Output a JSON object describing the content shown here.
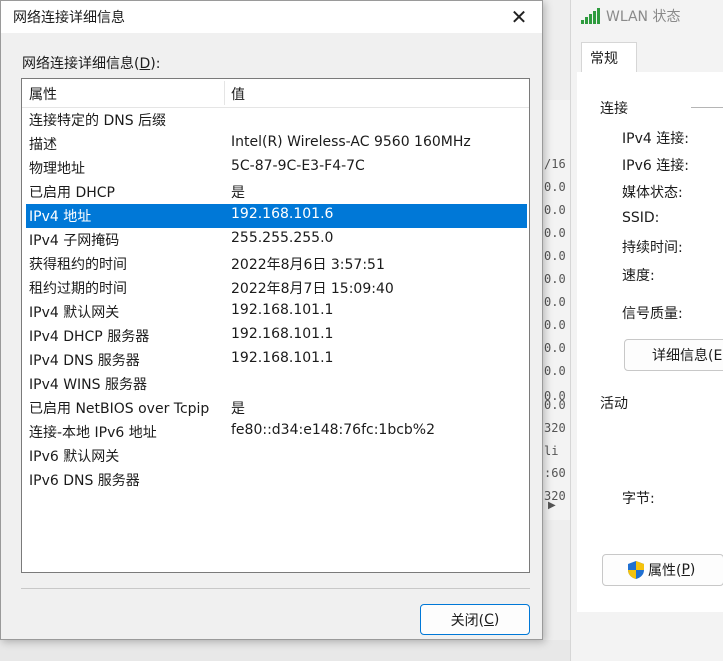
{
  "dialog": {
    "title": "网络连接详细信息",
    "list_label_prefix": "网络连接详细信息(",
    "list_label_accel": "D",
    "list_label_suffix": "):",
    "columns": {
      "property": "属性",
      "value": "值"
    },
    "rows": [
      {
        "property": "连接特定的 DNS 后缀",
        "value": ""
      },
      {
        "property": "描述",
        "value": "Intel(R) Wireless-AC 9560 160MHz"
      },
      {
        "property": "物理地址",
        "value": "5C-87-9C-E3-F4-7C"
      },
      {
        "property": "已启用 DHCP",
        "value": "是"
      },
      {
        "property": "IPv4 地址",
        "value": "192.168.101.6",
        "selected": true
      },
      {
        "property": "IPv4 子网掩码",
        "value": "255.255.255.0"
      },
      {
        "property": "获得租约的时间",
        "value": "2022年8月6日 3:57:51"
      },
      {
        "property": "租约过期的时间",
        "value": "2022年8月7日 15:09:40"
      },
      {
        "property": "IPv4 默认网关",
        "value": "192.168.101.1"
      },
      {
        "property": "IPv4 DHCP 服务器",
        "value": "192.168.101.1"
      },
      {
        "property": "IPv4 DNS 服务器",
        "value": "192.168.101.1"
      },
      {
        "property": "IPv4 WINS 服务器",
        "value": ""
      },
      {
        "property": "已启用 NetBIOS over Tcpip",
        "value": "是"
      },
      {
        "property": "连接-本地 IPv6 地址",
        "value": "fe80::d34:e148:76fc:1bcb%2"
      },
      {
        "property": "IPv6 默认网关",
        "value": ""
      },
      {
        "property": "IPv6 DNS 服务器",
        "value": ""
      }
    ],
    "close_button": {
      "prefix": "关闭(",
      "accel": "C",
      "suffix": ")"
    },
    "close_glyph": "✕"
  },
  "wlan": {
    "title": "WLAN 状态",
    "tab": "常规",
    "connection_section": "连接",
    "fields": [
      "IPv4 连接:",
      "IPv6 连接:",
      "媒体状态:",
      "SSID:",
      "持续时间:",
      "速度:"
    ],
    "signal_quality": "信号质量:",
    "details_button": "详细信息(E",
    "activity_section": "活动",
    "bytes_label": "字节:",
    "properties_button": {
      "prefix": "属性(",
      "accel": "P",
      "suffix": ")"
    }
  },
  "terminal": {
    "lines": [
      "/16",
      "0.0",
      "0.0",
      "0.0",
      "0.0",
      "0.0",
      "0.0",
      "0.0",
      "0.0",
      "0.0",
      "0.0",
      "0.0",
      "320",
      "li",
      ":60",
      "320"
    ],
    "scroll_arrow": "▶"
  },
  "colors": {
    "accent": "#0078d7",
    "signal": "#2e9b3e"
  }
}
